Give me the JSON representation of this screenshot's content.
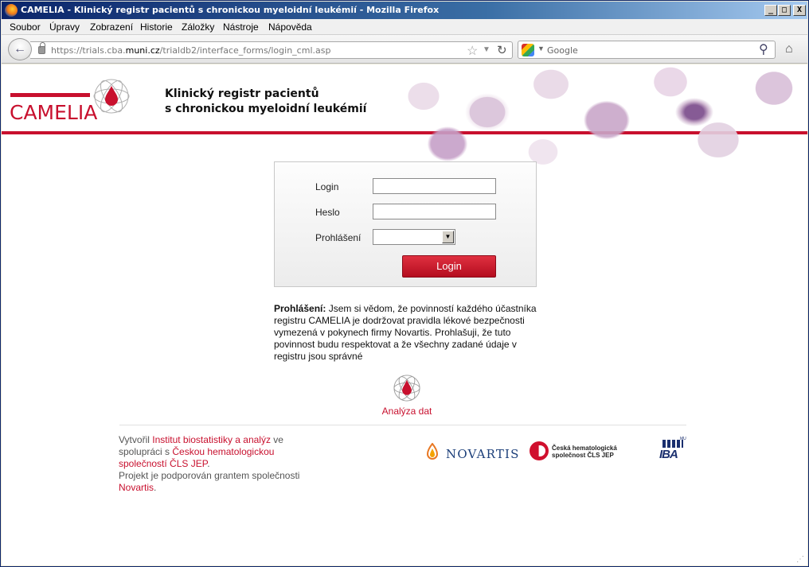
{
  "window": {
    "title": "CAMELIA - Klinický registr pacientů s chronickou myeloidní leukémií - Mozilla Firefox",
    "controls": {
      "minimize": "_",
      "maximize": "□",
      "close": "X"
    }
  },
  "menu": {
    "items": [
      "Soubor",
      "Úpravy",
      "Zobrazení",
      "Historie",
      "Záložky",
      "Nástroje",
      "Nápověda"
    ]
  },
  "navbar": {
    "url_prefix": "https://trials.cba.",
    "url_host": "muni.cz",
    "url_path": "/trialdb2/interface_forms/login_cml.asp",
    "search_placeholder": "Google",
    "icons": {
      "back": "back-arrow-icon",
      "lock": "lock-icon",
      "star": "bookmark-star-icon",
      "reload": "reload-icon",
      "search": "magnifier-icon",
      "home": "home-icon"
    }
  },
  "header": {
    "logo_text": "CAMELIA",
    "title_line1": "Klinický registr pacientů",
    "title_line2": "s chronickou myeloidní leukémií",
    "accent_color": "#c8102e"
  },
  "login_form": {
    "login_label": "Login",
    "login_value": "",
    "password_label": "Heslo",
    "password_value": "",
    "declaration_label": "Prohlášení",
    "declaration_selected": "",
    "submit_label": "Login"
  },
  "declaration": {
    "heading": "Prohlášení:",
    "text": "Jsem si vědom, že povinností každého účastníka registru CAMELIA je dodržovat pravidla lékové bezpečnosti vymezená v pokynech firmy Novartis. Prohlašuji, že tuto povinnost budu respektovat a že všechny zadané údaje v registru jsou správné"
  },
  "analyza": {
    "label": "Analýza dat"
  },
  "credits": {
    "t1": "Vytvořil ",
    "link1": "Institut biostatistiky a analýz",
    "t2": " ve spolupráci s ",
    "link2": "Českou hematologickou společností ČLS JEP",
    "t3": ".",
    "t4": "Projekt je podporován grantem společnosti ",
    "link3": "Novartis",
    "t5": "."
  },
  "partners": {
    "novartis": "NOVARTIS",
    "chs_line1": "Česká hematologická",
    "chs_line2": "společnost ČLS JEP",
    "iba": "IBA",
    "iba_small": "MU"
  }
}
